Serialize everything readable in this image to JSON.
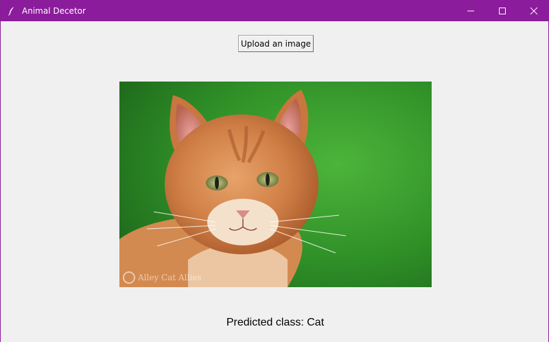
{
  "window": {
    "title": "Animal Decetor",
    "titlebar_color": "#8b1c9b",
    "controls": [
      "minimize-icon",
      "maximize-icon",
      "close-icon"
    ]
  },
  "main": {
    "upload_button_label": "Upload an image",
    "image": {
      "subject": "orange tabby cat portrait",
      "watermark": "Alley Cat Allies",
      "background_color": "#3a9a2c"
    },
    "prediction_text": "Predicted class: Cat"
  }
}
